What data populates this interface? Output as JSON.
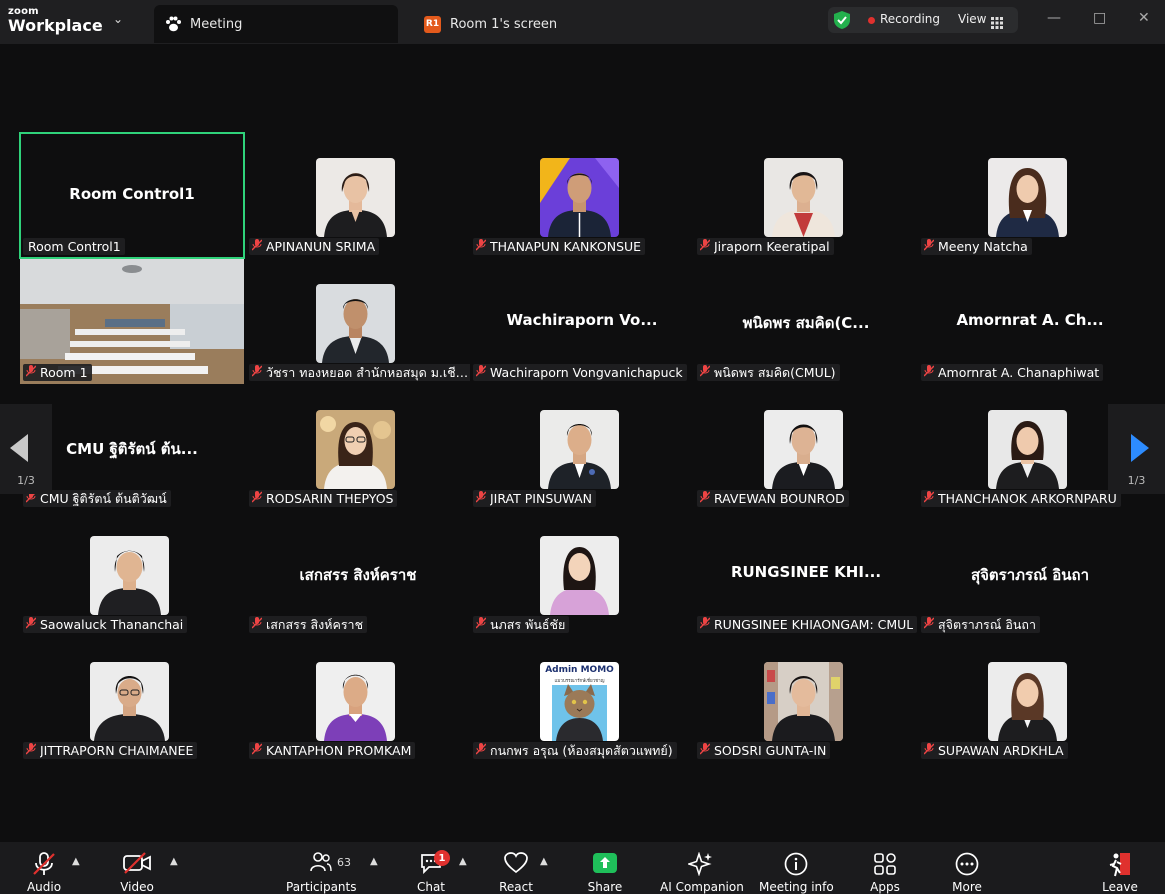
{
  "app": {
    "logo_top": "zoom",
    "logo_bottom": "Workplace"
  },
  "tabs": {
    "meeting": "Meeting",
    "room_badge": "R1",
    "room_screen": "Room 1's screen"
  },
  "status": {
    "recording": "Recording",
    "view": "View"
  },
  "pager": {
    "left": "1/3",
    "right": "1/3"
  },
  "tiles": [
    {
      "name": "Room Control1",
      "display": "Room Control1",
      "mode": "text"
    },
    {
      "name": "APINANUN SRIMA",
      "mode": "photo"
    },
    {
      "name": "THANAPUN KANKONSUE",
      "mode": "photo"
    },
    {
      "name": "Jiraporn Keeratipal",
      "mode": "photo"
    },
    {
      "name": "Meeny Natcha",
      "mode": "photo"
    },
    {
      "name": "Room 1",
      "mode": "room"
    },
    {
      "name": "วัชรา  ทองหยอด สำนักหอสมุด ม.เชียง...",
      "mode": "photo"
    },
    {
      "name": "Wachiraporn Vongvanichapuck",
      "display": "Wachiraporn  Vo...",
      "mode": "text"
    },
    {
      "name": "พนิดพร สมคิด(CMUL)",
      "display": "พนิดพร สมคิด(C...",
      "mode": "text"
    },
    {
      "name": "Amornrat A. Chanaphiwat",
      "display": "Amornrat A. Ch...",
      "mode": "text"
    },
    {
      "name": "CMU ฐิติรัตน์ ต้นติวัฒน์",
      "display": "CMU ฐิติรัตน์ ต้น...",
      "mode": "text"
    },
    {
      "name": "RODSARIN THEPYOS",
      "mode": "photo"
    },
    {
      "name": "JIRAT PINSUWAN",
      "mode": "photo"
    },
    {
      "name": "RAVEWAN BOUNROD",
      "mode": "photo"
    },
    {
      "name": "THANCHANOK ARKORNPARU",
      "mode": "photo"
    },
    {
      "name": "Saowaluck Thananchai",
      "mode": "photo"
    },
    {
      "name": "เสกสรร สิงห์คราช",
      "display": "เสกสรร สิงห์คราช",
      "mode": "text"
    },
    {
      "name": "นภสร พันธ์ชัย",
      "mode": "photo"
    },
    {
      "name": "RUNGSINEE KHIAONGAM: CMUL",
      "display": "RUNGSINEE KHI...",
      "mode": "text"
    },
    {
      "name": "สุจิตราภรณ์ อินถา",
      "display": "สุจิตราภรณ์ อินถา",
      "mode": "text"
    },
    {
      "name": "JITTRAPORN CHAIMANEE",
      "mode": "photo"
    },
    {
      "name": "KANTAPHON PROMKAM",
      "mode": "photo"
    },
    {
      "name": "กนกพร  อรุณ (ห้องสมุดสัตวแพทย์)",
      "mode": "photo",
      "poster_title": "Admin MOMO",
      "poster_sub": "แมวบรรณารักษ์เชี่ยวชาญ"
    },
    {
      "name": "SODSRI GUNTA-IN",
      "mode": "photo"
    },
    {
      "name": "SUPAWAN ARDKHLA",
      "mode": "photo"
    }
  ],
  "toolbar": {
    "audio": "Audio",
    "video": "Video",
    "participants": "Participants",
    "participant_count": "63",
    "chat": "Chat",
    "chat_badge": "1",
    "react": "React",
    "share": "Share",
    "ai_companion": "AI Companion",
    "meeting_info": "Meeting info",
    "apps": "Apps",
    "more": "More",
    "leave": "Leave"
  },
  "colors": {
    "active_border": "#2fd27a",
    "share_green": "#1fbf5a",
    "accent_blue": "#2d8cff",
    "alert_red": "#e0312e"
  }
}
